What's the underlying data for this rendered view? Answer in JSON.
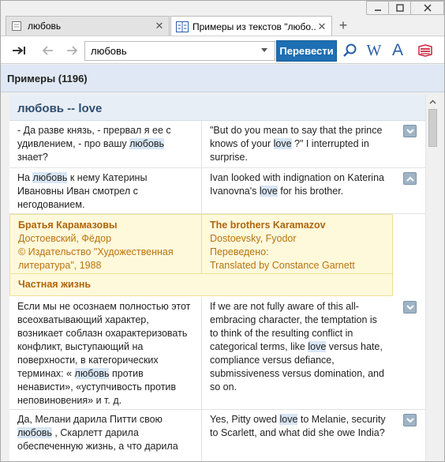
{
  "tabs": [
    {
      "label": "любовь",
      "close": "✕"
    },
    {
      "label": "Примеры из текстов \"любо...",
      "close": "✕"
    }
  ],
  "new_tab": "+",
  "toolbar": {
    "search_value": "любовь",
    "translate_label": "Перевести",
    "w_label": "W",
    "a_label": "A"
  },
  "header": {
    "title": "Примеры (1196)"
  },
  "entry": {
    "title": "любовь -- love"
  },
  "rows": [
    {
      "ru": [
        "- Да разве князь, - прервал я ее с удивлением, - про вашу ",
        "любовь",
        " знает?"
      ],
      "en": [
        "\"But do you mean to say that the prince knows of your ",
        "love",
        " ?\" I interrupted in surprise."
      ],
      "expanded": false
    },
    {
      "ru": [
        "На ",
        "любовь",
        " к нему Катерины Ивановны Иван смотрел с негодованием."
      ],
      "en": [
        "Ivan looked with indignation on Katerina Ivanovna's ",
        "love",
        " for his brother."
      ],
      "expanded": true
    },
    {
      "ru": [
        "Если мы не осознаем полностью этот всеохватывающий характер, возникает соблазн охарактеризовать конфликт, выступающий на поверхности, в категорических терминах: « ",
        "любовь",
        " против ненависти», «уступчивость против неповиновения» и т. д."
      ],
      "en": [
        "If we are not fully aware of this all-embracing character, the temptation is to think of the resulting conflict in categorical terms, like ",
        "love",
        " versus hate, compliance versus defiance, submissiveness versus domination, and so on."
      ],
      "expanded": false
    },
    {
      "ru": [
        "Да, Мелани дарила Питти свою ",
        "любовь",
        " , Скарлетт дарила обеспеченную жизнь, а что дарила"
      ],
      "en": [
        "Yes, Pitty owed ",
        "love",
        " to Melanie, security to Scarlett, and what did she owe India?"
      ],
      "expanded": false
    }
  ],
  "source": {
    "ru_title": "Братья Карамазовы",
    "ru_author": "Достоевский, Фёдор",
    "ru_publisher": "© Издательство \"Художественная литература\", 1988",
    "en_title": "The brothers Karamazov",
    "en_author": "Dostoevsky, Fyodor",
    "en_translated": "Переведено:",
    "en_translator": "Translated by Constance Garnett",
    "section": "Частная жизнь"
  }
}
